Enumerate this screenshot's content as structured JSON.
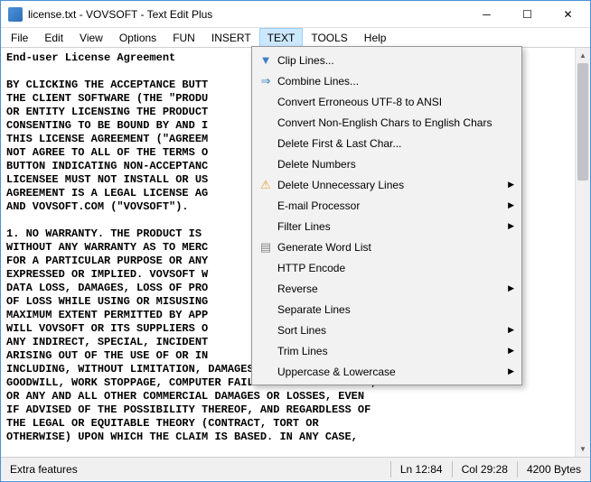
{
  "window": {
    "title": "license.txt - VOVSOFT - Text Edit Plus"
  },
  "menu": {
    "items": [
      "File",
      "Edit",
      "View",
      "Options",
      "FUN",
      "INSERT",
      "TEXT",
      "TOOLS",
      "Help"
    ],
    "active_index": 6
  },
  "dropdown": {
    "items": [
      {
        "label": "Clip Lines...",
        "icon": "funnel",
        "submenu": false
      },
      {
        "label": "Combine Lines...",
        "icon": "combine",
        "submenu": false
      },
      {
        "label": "Convert Erroneous UTF-8 to ANSI",
        "icon": "",
        "submenu": false
      },
      {
        "label": "Convert Non-English Chars to English Chars",
        "icon": "",
        "submenu": false
      },
      {
        "label": "Delete First & Last Char...",
        "icon": "",
        "submenu": false
      },
      {
        "label": "Delete Numbers",
        "icon": "",
        "submenu": false
      },
      {
        "label": "Delete Unnecessary Lines",
        "icon": "warn",
        "submenu": true
      },
      {
        "label": "E-mail Processor",
        "icon": "",
        "submenu": true
      },
      {
        "label": "Filter Lines",
        "icon": "",
        "submenu": true
      },
      {
        "label": "Generate Word List",
        "icon": "doc",
        "submenu": false
      },
      {
        "label": "HTTP Encode",
        "icon": "",
        "submenu": false
      },
      {
        "label": "Reverse",
        "icon": "",
        "submenu": true
      },
      {
        "label": "Separate Lines",
        "icon": "",
        "submenu": false
      },
      {
        "label": "Sort Lines",
        "icon": "",
        "submenu": true
      },
      {
        "label": "Trim Lines",
        "icon": "",
        "submenu": true
      },
      {
        "label": "Uppercase & Lowercase",
        "icon": "",
        "submenu": true
      }
    ]
  },
  "editor": {
    "content": "End-user License Agreement\n\nBY CLICKING THE ACCEPTANCE BUTT\nTHE CLIENT SOFTWARE (THE \"PRODU\nOR ENTITY LICENSING THE PRODUCT\nCONSENTING TO BE BOUND BY AND I\nTHIS LICENSE AGREEMENT (\"AGREEM\nNOT AGREE TO ALL OF THE TERMS O\nBUTTON INDICATING NON-ACCEPTANC\nLICENSEE MUST NOT INSTALL OR US\nAGREEMENT IS A LEGAL LICENSE AG\nAND VOVSOFT.COM (\"VOVSOFT\").\n\n1. NO WARRANTY. THE PRODUCT IS\nWITHOUT ANY WARRANTY AS TO MERC\nFOR A PARTICULAR PURPOSE OR ANY\nEXPRESSED OR IMPLIED. VOVSOFT W\nDATA LOSS, DAMAGES, LOSS OF PRO\nOF LOSS WHILE USING OR MISUSING\nMAXIMUM EXTENT PERMITTED BY APP\nWILL VOVSOFT OR ITS SUPPLIERS O\nANY INDIRECT, SPECIAL, INCIDENT\nARISING OUT OF THE USE OF OR IN\nINCLUDING, WITHOUT LIMITATION, DAMAGES FOR LOSS OF\nGOODWILL, WORK STOPPAGE, COMPUTER FAILURE OR MALFUNCTION,\nOR ANY AND ALL OTHER COMMERCIAL DAMAGES OR LOSSES, EVEN\nIF ADVISED OF THE POSSIBILITY THEREOF, AND REGARDLESS OF\nTHE LEGAL OR EQUITABLE THEORY (CONTRACT, TORT OR\nOTHERWISE) UPON WHICH THE CLAIM IS BASED. IN ANY CASE,"
  },
  "status": {
    "left": "Extra features",
    "ln": "Ln 12:84",
    "col": "Col 29:28",
    "bytes": "4200 Bytes"
  }
}
